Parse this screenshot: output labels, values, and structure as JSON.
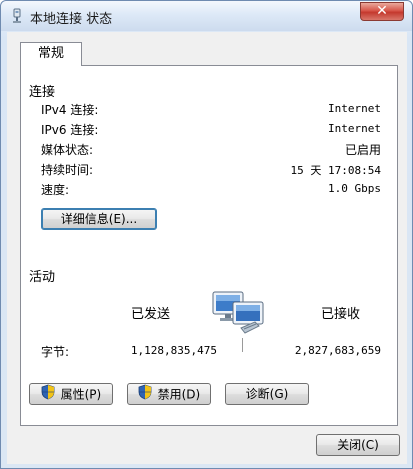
{
  "window": {
    "title": "本地连接 状态",
    "close_glyph": "✕"
  },
  "tabs": [
    {
      "label": "常规"
    }
  ],
  "connection": {
    "section_title": "连接",
    "rows": [
      {
        "label": "IPv4 连接:",
        "value": "Internet"
      },
      {
        "label": "IPv6 连接:",
        "value": "Internet"
      },
      {
        "label": "媒体状态:",
        "value": "已启用"
      },
      {
        "label": "持续时间:",
        "value": "15 天 17:08:54"
      },
      {
        "label": "速度:",
        "value": "1.0 Gbps"
      }
    ],
    "details_button": "详细信息(E)..."
  },
  "activity": {
    "section_title": "活动",
    "sent_label": "已发送",
    "received_label": "已接收",
    "bytes_label": "字节:",
    "bytes_sent": "1,128,835,475",
    "bytes_received": "2,827,683,659"
  },
  "buttons": {
    "properties": "属性(P)",
    "disable": "禁用(D)",
    "diagnose": "诊断(G)",
    "close": "关闭(C)"
  },
  "icons": {
    "title": "network-connection-icon",
    "shield": "uac-shield-icon",
    "computers": "network-activity-icon"
  },
  "colors": {
    "accent": "#3c7fb1",
    "shield_blue": "#2f64b3",
    "shield_yellow": "#f2c318"
  }
}
